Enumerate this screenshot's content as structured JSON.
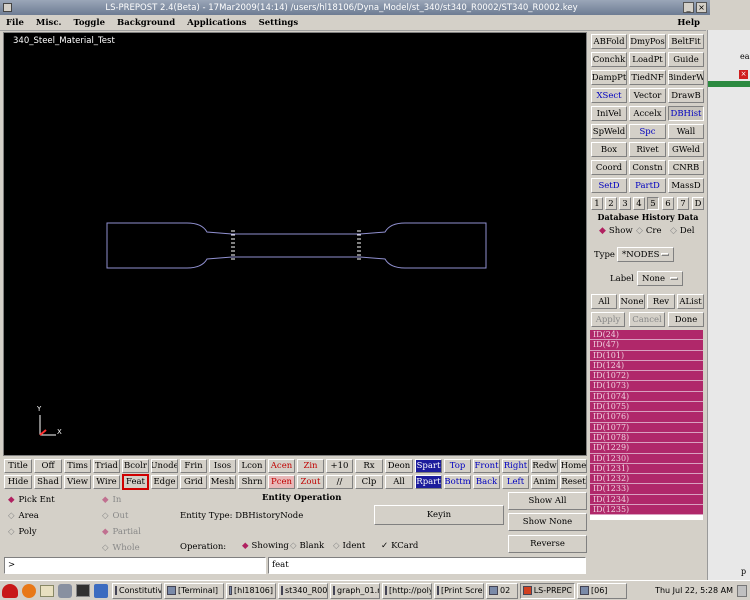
{
  "window": {
    "title": "LS-PREPOST 2.4(Beta) - 17Mar2009(14:14) /users/hl18106/Dyna_Model/st_340/st340_R0002/ST340_R0002.key"
  },
  "menu": {
    "items": [
      "File",
      "Misc.",
      "Toggle",
      "Background",
      "Applications",
      "Settings"
    ],
    "help": "Help"
  },
  "viewport": {
    "label": "340_Steel_Material_Test",
    "axis_y": "Y",
    "axis_x": "X"
  },
  "right_panel": {
    "rows": [
      [
        "ABFold",
        "DmyPos",
        "BeltFit"
      ],
      [
        "Conchk",
        "LoadPt",
        "Guide"
      ],
      [
        "DampPt",
        "TiedNF",
        "BinderW"
      ],
      [
        "XSect",
        "Vector",
        "DrawB"
      ],
      [
        "IniVel",
        "Accelx",
        "DBHist"
      ],
      [
        "SpWeld",
        "Spc",
        "Wall"
      ],
      [
        "Box",
        "Rivet",
        "GWeld"
      ],
      [
        "Coord",
        "Constn",
        "CNRB"
      ],
      [
        "SetD",
        "PartD",
        "MassD"
      ]
    ],
    "pages": [
      "1",
      "2",
      "3",
      "4",
      "5",
      "6",
      "7",
      "D"
    ],
    "section_title": "Database History Data",
    "radios": [
      "Show",
      "Cre",
      "Del"
    ],
    "type_label": "Type",
    "type_value": "*NODES",
    "label_label": "Label",
    "label_value": "None",
    "select_buttons": [
      "All",
      "None",
      "Rev",
      "AList"
    ],
    "action_buttons": [
      "Apply",
      "Cancel",
      "Done"
    ],
    "ids": [
      "ID(24)",
      "ID(47)",
      "ID(101)",
      "ID(124)",
      "ID(1072)",
      "ID(1073)",
      "ID(1074)",
      "ID(1075)",
      "ID(1076)",
      "ID(1077)",
      "ID(1078)",
      "ID(1229)",
      "ID(1230)",
      "ID(1231)",
      "ID(1232)",
      "ID(1233)",
      "ID(1234)",
      "ID(1235)"
    ]
  },
  "toolbar": {
    "row1": [
      "Title",
      "Off",
      "Tims",
      "Triad",
      "Bcolr",
      "Unode",
      "Frin",
      "Isos",
      "Lcon",
      "Acen",
      "Zin",
      "+10",
      "Rx",
      "Deon",
      "Spart",
      "Top",
      "Front",
      "Right",
      "Redw",
      "Home"
    ],
    "row2": [
      "Hide",
      "Shad",
      "View",
      "Wire",
      "Feat",
      "Edge",
      "Grid",
      "Mesh",
      "Shrn",
      "Pcen",
      "Zout",
      "//",
      "Clp",
      "All",
      "Rpart",
      "Bottm",
      "Back",
      "Left",
      "Anim",
      "Reset"
    ]
  },
  "entity": {
    "pick": [
      "Pick Ent",
      "Area",
      "Poly"
    ],
    "mode": [
      "In",
      "Out",
      "Partial",
      "Whole"
    ],
    "title": "Entity Operation",
    "type_text": "Entity Type: DBHistoryNode",
    "keyin": "Keyin",
    "operation_label": "Operation:",
    "operations": [
      "Showing",
      "Blank",
      "Ident",
      "KCard"
    ],
    "side_buttons": [
      "Show All",
      "Show None",
      "Reverse"
    ]
  },
  "command": {
    "prompt": ">",
    "history": "feat"
  },
  "taskbar": {
    "tasks": [
      "Constitutiv",
      "[Terminal]",
      "[hl18106]",
      "st340_R00",
      "graph_01.n",
      "[http://poly",
      "[Print Scre",
      "02",
      "LS-PREPC",
      "[06]"
    ],
    "clock": "Thu Jul 22,  5:28 AM"
  },
  "behind": {
    "text_a": "ea",
    "text_b": "p"
  }
}
